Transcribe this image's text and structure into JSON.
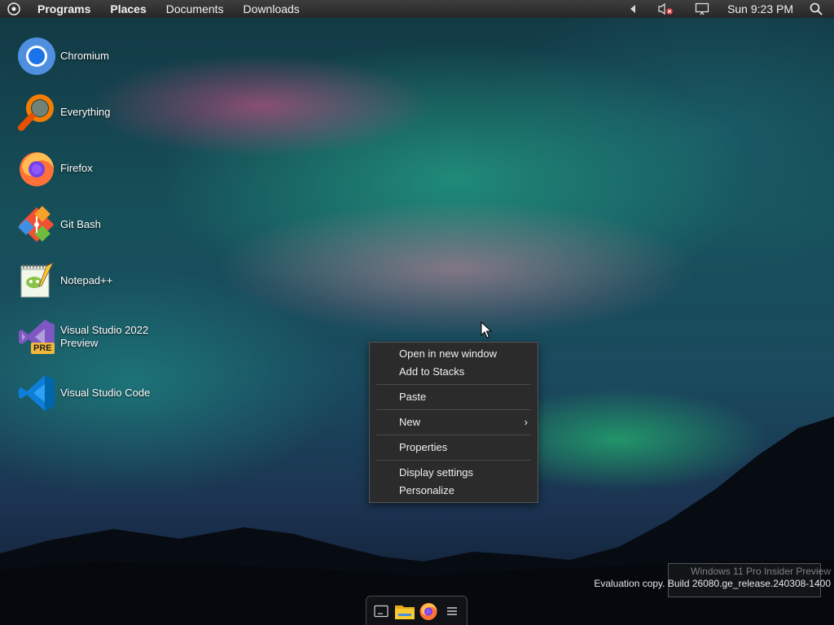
{
  "top_panel": {
    "menus": [
      "Programs",
      "Places",
      "Documents",
      "Downloads"
    ],
    "clock": "Sun 9:23 PM"
  },
  "desktop_icons": [
    {
      "label": "Chromium",
      "icon": "chromium-icon"
    },
    {
      "label": "Everything",
      "icon": "everything-search-icon"
    },
    {
      "label": "Firefox",
      "icon": "firefox-icon"
    },
    {
      "label": "Git Bash",
      "icon": "git-bash-icon"
    },
    {
      "label": "Notepad++",
      "icon": "notepad-plus-plus-icon"
    },
    {
      "label": "Visual Studio 2022 Preview",
      "icon": "visual-studio-icon",
      "badge": "PRE"
    },
    {
      "label": "Visual Studio Code",
      "icon": "vscode-icon"
    }
  ],
  "context_menu": {
    "items": [
      "Open in new window",
      "Add to Stacks",
      "Paste",
      "New",
      "Properties",
      "Display settings",
      "Personalize"
    ]
  },
  "dock": {
    "items": [
      "terminal-icon",
      "file-manager-icon",
      "firefox-icon",
      "menu-icon"
    ]
  },
  "watermark": {
    "line1": "Windows 11 Pro Insider Preview",
    "line2": "Evaluation copy. Build 26080.ge_release.240308-1400"
  },
  "colors": {
    "panel_bg": "#2e2e2e",
    "menu_bg": "#2b2b2b",
    "vs_purple": "#7e57c2",
    "vscode_blue": "#0e7fd8"
  }
}
